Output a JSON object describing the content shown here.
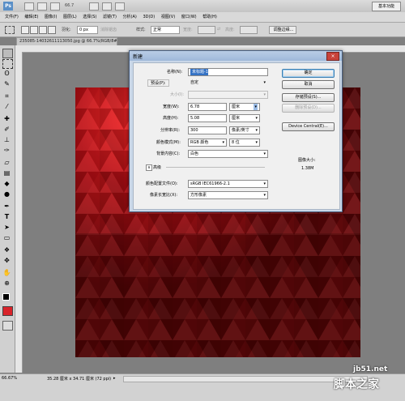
{
  "app": {
    "logo": "Ps",
    "zoom": "66.7",
    "workspace": "基本功能",
    "min_btn": "−",
    "max_btn": "□",
    "close_btn": "×"
  },
  "menu": [
    "文件(F)",
    "编辑(E)",
    "图像(I)",
    "图层(L)",
    "选择(S)",
    "滤镜(T)",
    "分析(A)",
    "3D(D)",
    "视图(V)",
    "窗口(W)",
    "帮助(H)"
  ],
  "options": {
    "feather_label": "羽化:",
    "feather_value": "0 px",
    "antialias": "消除锯齿",
    "style_label": "样式:",
    "style_value": "正常",
    "width_label": "宽度:",
    "height_label": "高度:",
    "refine_btn": "调整边缘..."
  },
  "document": {
    "tab": "235085-14032611113050.jpg @ 66.7%(RGB/8#)"
  },
  "status": {
    "zoom": "66.67%",
    "doc_info": "35.28 厘米 x 34.71 厘米 (72 ppi)"
  },
  "watermark": {
    "site": "jb51.net",
    "brand": "脚本之家"
  },
  "dialog": {
    "title": "新建",
    "close": "×",
    "name_label": "名称(N):",
    "name_value": "未标题-1",
    "preset_label": "预设(P):",
    "preset_value": "自定",
    "size_label": "大小(I):",
    "width_label": "宽度(W):",
    "width_value": "6.78",
    "width_unit": "厘米",
    "height_label": "高度(H):",
    "height_value": "5.08",
    "height_unit": "厘米",
    "res_label": "分辨率(R):",
    "res_value": "300",
    "res_unit": "像素/英寸",
    "color_mode_label": "颜色模式(M):",
    "color_mode_value": "RGB 颜色",
    "bit_depth": "8 位",
    "bg_label": "背景内容(C):",
    "bg_value": "白色",
    "advanced_label": "高级",
    "profile_label": "颜色配置文件(O):",
    "profile_value": "sRGB IEC61966-2.1",
    "pixel_ratio_label": "像素长宽比(X):",
    "pixel_ratio_value": "方形像素",
    "ok": "确定",
    "cancel": "取消",
    "save_preset": "存储预设(S)...",
    "delete_preset": "删除预设(D)...",
    "device_central": "Device Central(E)...",
    "image_size_label": "图像大小:",
    "image_size_value": "1.38M"
  },
  "colors": {
    "canvas_dark": "#6e0608",
    "canvas_red": "#c0121a",
    "foreground": "#000000",
    "background": "#d8232a"
  }
}
